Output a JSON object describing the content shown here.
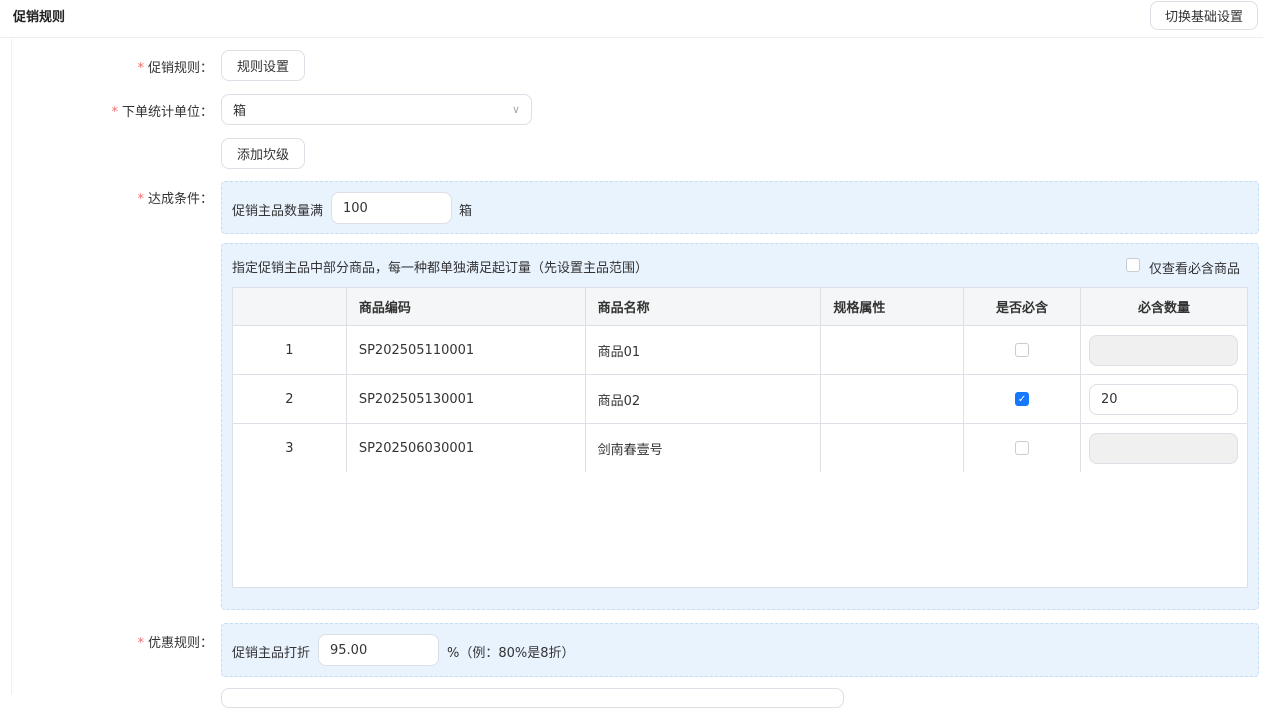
{
  "header": {
    "title": "促销规则",
    "switch_button": "切换基础设置"
  },
  "form": {
    "rule_label": "促销规则：",
    "rule_button": "规则设置",
    "unit_label": "下单统计单位：",
    "unit_value": "箱",
    "add_level_button": "添加坎级",
    "condition_label": "达成条件：",
    "condition_prefix": "促销主品数量满",
    "condition_value": "100",
    "condition_unit": "箱",
    "partial_text": "指定促销主品中部分商品，每一种都单独满足起订量（先设置主品范围）",
    "only_required_label": "仅查看必含商品",
    "discount_label": "优惠规则：",
    "discount_prefix": "促销主品打折",
    "discount_value": "95.00",
    "discount_suffix": "%（例：80%是8折）"
  },
  "table": {
    "headers": [
      "",
      "商品编码",
      "商品名称",
      "规格属性",
      "是否必含",
      "必含数量"
    ],
    "rows": [
      {
        "index": "1",
        "code": "SP202505110001",
        "name": "商品01",
        "spec": "",
        "required": false,
        "qty": ""
      },
      {
        "index": "2",
        "code": "SP202505130001",
        "name": "商品02",
        "spec": "",
        "required": true,
        "qty": "20"
      },
      {
        "index": "3",
        "code": "SP202506030001",
        "name": "剑南春壹号",
        "spec": "",
        "required": false,
        "qty": ""
      }
    ]
  }
}
